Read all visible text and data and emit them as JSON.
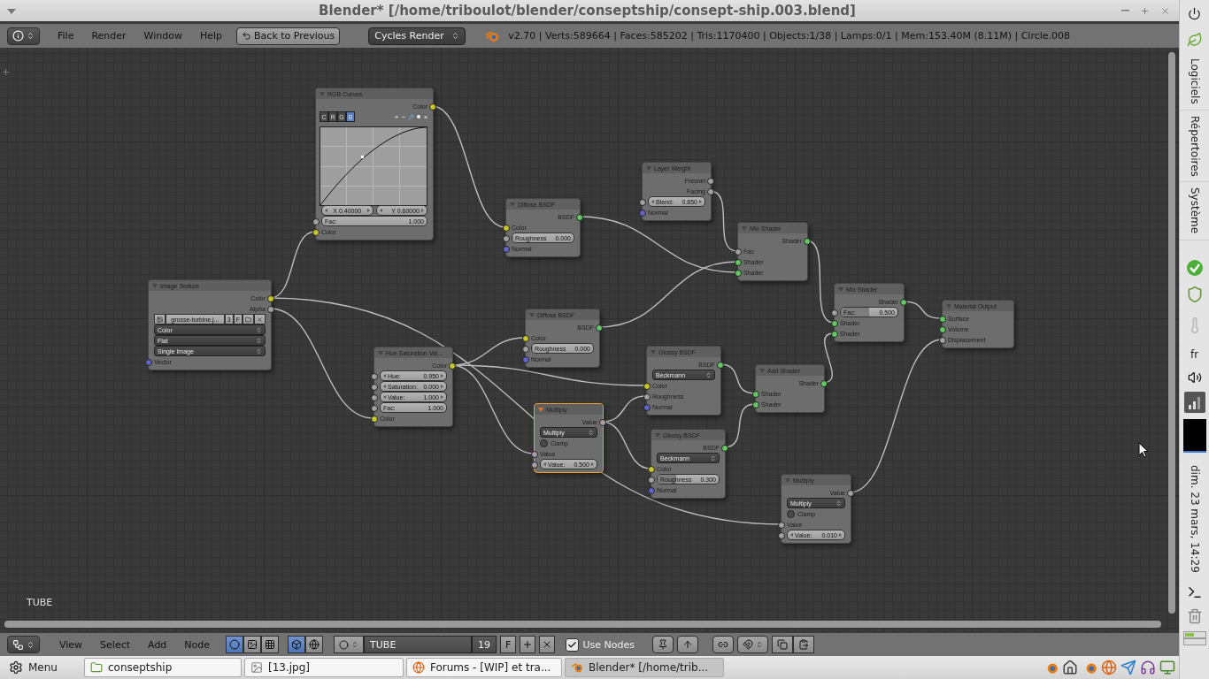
{
  "window": {
    "title": "Blender* [/home/triboulot/blender/conseptship/consept-ship.003.blend]"
  },
  "top_header": {
    "menus": [
      "File",
      "Render",
      "Window",
      "Help"
    ],
    "back_button": "Back to Previous",
    "render_engine": "Cycles Render",
    "stats": "v2.70 | Verts:589664 | Faces:585202 | Tris:1170400 | Objects:1/38 | Lamps:0/1 | Mem:153.40M (8.11M) | Circle.008"
  },
  "node_editor": {
    "object_label": "TUBE",
    "nodes": [
      {
        "title": "RGB Curves",
        "selected": false,
        "rows": [
          {
            "kind": "output",
            "label": "Color",
            "color": "#c7c729"
          },
          {
            "kind": "curve",
            "channels": [
              {
                "label": "C",
                "selected": false
              },
              {
                "label": "R",
                "selected": false
              },
              {
                "label": "G",
                "selected": false
              },
              {
                "label": "B",
                "selected": true
              }
            ],
            "tools": [
              {
                "kind": "text",
                "label": "+"
              },
              {
                "kind": "text",
                "label": "−"
              },
              {
                "kind": "wrench"
              },
              {
                "kind": "point"
              },
              {
                "kind": "text",
                "label": "×"
              }
            ]
          },
          {
            "kind": "xy",
            "x": "X 0.40000",
            "y": "Y 0.60000"
          },
          {
            "kind": "field",
            "label": "Fac:",
            "value": "1.000",
            "color": "#a1a1a1",
            "stepper": false
          },
          {
            "kind": "input",
            "label": "Color",
            "color": "#c7c729"
          }
        ]
      },
      {
        "title": "Layer Weight",
        "selected": false,
        "rows": [
          {
            "kind": "output",
            "label": "Fresnel",
            "color": "#a1a1a1"
          },
          {
            "kind": "output",
            "label": "Facing",
            "color": "#a1a1a1"
          },
          {
            "kind": "field",
            "label": "Blend:",
            "value": "0.850",
            "color": "#a1a1a1",
            "stepper": true
          },
          {
            "kind": "input",
            "label": "Normal",
            "color": "#6363c7"
          }
        ]
      },
      {
        "title": "Diffuse BSDF",
        "selected": false,
        "rows": [
          {
            "kind": "output",
            "label": "BSDF",
            "color": "#63c763"
          },
          {
            "kind": "input",
            "label": "Color",
            "color": "#c7c729"
          },
          {
            "kind": "slider",
            "label": "Roughness",
            "value": "0.000",
            "level": 0,
            "color": "#a1a1a1"
          },
          {
            "kind": "input",
            "label": "Normal",
            "color": "#6363c7"
          }
        ]
      },
      {
        "title": "Mix Shader",
        "selected": false,
        "rows": [
          {
            "kind": "output",
            "label": "Shader",
            "color": "#63c763"
          },
          {
            "kind": "input",
            "label": "Fac",
            "color": "#a1a1a1"
          },
          {
            "kind": "input",
            "label": "Shader",
            "color": "#63c763"
          },
          {
            "kind": "input",
            "label": "Shader",
            "color": "#63c763"
          }
        ]
      },
      {
        "title": "Image Texture",
        "selected": false,
        "rows": [
          {
            "kind": "output",
            "label": "Color",
            "color": "#c7c729"
          },
          {
            "kind": "output",
            "label": "Alpha",
            "color": "#a1a1a1"
          },
          {
            "kind": "image",
            "file": "grosse-turbine.j...",
            "users": "3",
            "fake_user": "F"
          },
          {
            "kind": "dropdown",
            "value": "Color"
          },
          {
            "kind": "dropdown",
            "value": "Flat"
          },
          {
            "kind": "dropdown",
            "value": "Single Image"
          },
          {
            "kind": "input",
            "label": "Vector",
            "color": "#6363c7"
          }
        ]
      },
      {
        "title": "Mix Shader",
        "selected": false,
        "rows": [
          {
            "kind": "output",
            "label": "Shader",
            "color": "#63c763"
          },
          {
            "kind": "slider",
            "label": "Fac:",
            "value": "0.500",
            "level": 0.5,
            "color": "#a1a1a1"
          },
          {
            "kind": "input",
            "label": "Shader",
            "color": "#63c763"
          },
          {
            "kind": "input",
            "label": "Shader",
            "color": "#63c763"
          }
        ]
      },
      {
        "title": "Material Output",
        "selected": false,
        "rows": [
          {
            "kind": "input",
            "label": "Surface",
            "color": "#63c763"
          },
          {
            "kind": "input",
            "label": "Volume",
            "color": "#63c763"
          },
          {
            "kind": "input",
            "label": "Displacement",
            "color": "#a1a1a1"
          }
        ]
      },
      {
        "title": "Diffuse BSDF",
        "selected": false,
        "rows": [
          {
            "kind": "output",
            "label": "BSDF",
            "color": "#63c763"
          },
          {
            "kind": "input",
            "label": "Color",
            "color": "#c7c729"
          },
          {
            "kind": "slider",
            "label": "Roughness",
            "value": "0.000",
            "level": 0,
            "color": "#a1a1a1"
          },
          {
            "kind": "input",
            "label": "Normal",
            "color": "#6363c7"
          }
        ]
      },
      {
        "title": "Hue Saturation Val...",
        "selected": false,
        "rows": [
          {
            "kind": "output",
            "label": "Color",
            "color": "#c7c729"
          },
          {
            "kind": "field",
            "label": "Hue:",
            "value": "0.950",
            "color": "#a1a1a1",
            "stepper": true
          },
          {
            "kind": "field",
            "label": "Saturation:",
            "value": "0.000",
            "color": "#a1a1a1",
            "stepper": true
          },
          {
            "kind": "field",
            "label": "Value:",
            "value": "1.000",
            "color": "#a1a1a1",
            "stepper": true
          },
          {
            "kind": "field",
            "label": "Fac:",
            "value": "1.000",
            "color": "#a1a1a1",
            "stepper": false
          },
          {
            "kind": "input",
            "label": "Color",
            "color": "#c7c729"
          }
        ]
      },
      {
        "title": "Glossy BSDF",
        "selected": false,
        "rows": [
          {
            "kind": "output",
            "label": "BSDF",
            "color": "#63c763"
          },
          {
            "kind": "dropdown",
            "value": "Beckmann"
          },
          {
            "kind": "input",
            "label": "Color",
            "color": "#c7c729"
          },
          {
            "kind": "input",
            "label": "Roughness",
            "color": "#a1a1a1"
          },
          {
            "kind": "input",
            "label": "Normal",
            "color": "#6363c7"
          }
        ]
      },
      {
        "title": "Add Shader",
        "selected": false,
        "rows": [
          {
            "kind": "output",
            "label": "Shader",
            "color": "#63c763"
          },
          {
            "kind": "input",
            "label": "Shader",
            "color": "#63c763"
          },
          {
            "kind": "input",
            "label": "Shader",
            "color": "#63c763"
          }
        ]
      },
      {
        "title": "Multiply",
        "selected": true,
        "rows": [
          {
            "kind": "output",
            "label": "Value",
            "color": "#a1a1a1"
          },
          {
            "kind": "dropdown",
            "value": "Multiply"
          },
          {
            "kind": "checkbox",
            "label": "Clamp",
            "checked": false
          },
          {
            "kind": "input",
            "label": "Value",
            "color": "#a1a1a1"
          },
          {
            "kind": "field",
            "label": "Value:",
            "value": "0.500",
            "color": "#a1a1a1",
            "stepper": true
          }
        ]
      },
      {
        "title": "Glossy BSDF",
        "selected": false,
        "rows": [
          {
            "kind": "output",
            "label": "BSDF",
            "color": "#63c763"
          },
          {
            "kind": "dropdown",
            "value": "Beckmann"
          },
          {
            "kind": "input",
            "label": "Color",
            "color": "#c7c729"
          },
          {
            "kind": "slider",
            "label": "Roughness",
            "value": "0.300",
            "level": 0.3,
            "color": "#a1a1a1"
          },
          {
            "kind": "input",
            "label": "Normal",
            "color": "#6363c7"
          }
        ]
      },
      {
        "title": "Multiply",
        "selected": false,
        "rows": [
          {
            "kind": "output",
            "label": "Value",
            "color": "#a1a1a1"
          },
          {
            "kind": "dropdown",
            "value": "Multiply"
          },
          {
            "kind": "checkbox",
            "label": "Clamp",
            "checked": false
          },
          {
            "kind": "input",
            "label": "Value",
            "color": "#a1a1a1"
          },
          {
            "kind": "field",
            "label": "Value:",
            "value": "0.010",
            "color": "#a1a1a1",
            "stepper": true
          }
        ]
      }
    ]
  },
  "bottom_header": {
    "menus": [
      "View",
      "Select",
      "Add",
      "Node"
    ],
    "shader_types": [
      {
        "selected": true
      },
      {
        "selected": false
      },
      {
        "selected": false
      }
    ],
    "shader_sources": [
      {
        "selected": true
      },
      {
        "selected": false
      }
    ],
    "material_name": "TUBE",
    "users": "19",
    "fake_user": "F",
    "use_nodes": {
      "label": "Use Nodes",
      "checked": true
    }
  },
  "taskbar": {
    "menu": "Menu",
    "windows": [
      {
        "kind": "folder",
        "label": "conseptship",
        "selected": false
      },
      {
        "kind": "image",
        "label": "[13.jpg]",
        "selected": false
      },
      {
        "kind": "browser",
        "label": "Forums - [WIP] et tra...",
        "selected": false
      },
      {
        "kind": "blender",
        "label": "Blender* [/home/trib...",
        "selected": true
      }
    ]
  },
  "side_panel": {
    "menus": [
      "Logiciels",
      "Répertoires",
      "Système"
    ],
    "keyboard_layout": "fr",
    "clock": "dim. 23 mars, 14:29"
  }
}
